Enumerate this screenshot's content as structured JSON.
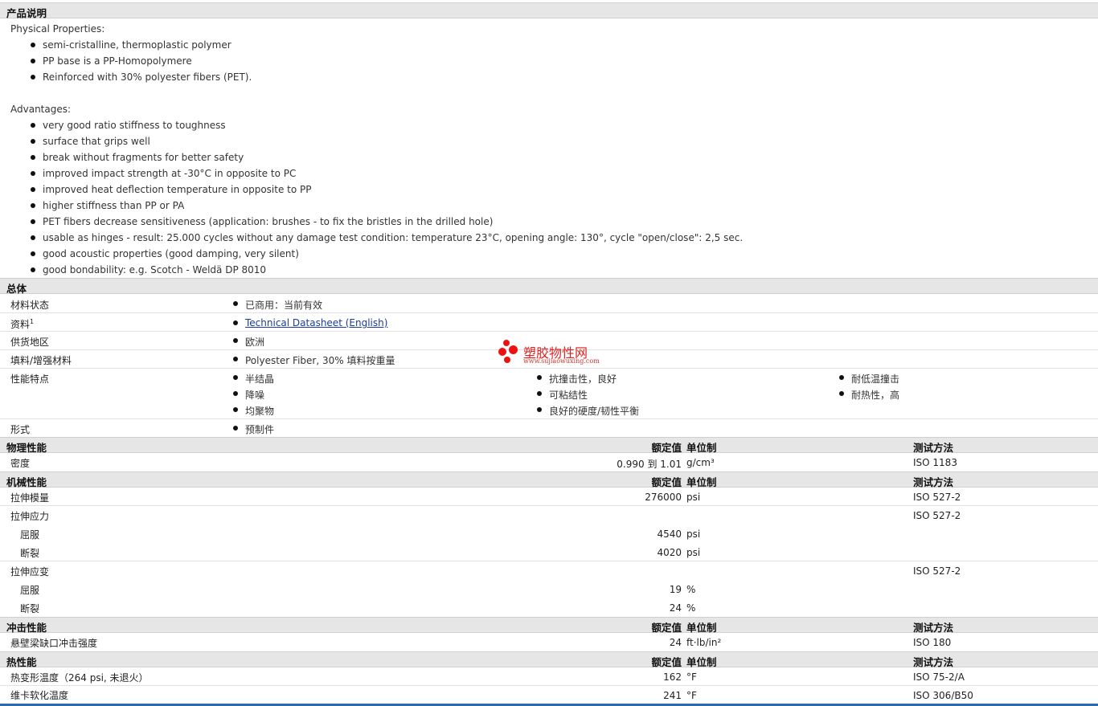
{
  "product_description": {
    "header": "产品说明",
    "physical_title": "Physical Properties:",
    "physical": [
      "semi-cristalline, thermoplastic polymer",
      "PP base is a PP-Homopolymere",
      "Reinforced with 30% polyester fibers (PET)."
    ],
    "advantages_title": "Advantages:",
    "advantages": [
      "very good ratio stiffness to toughness",
      "surface that grips well",
      "break without fragments for better safety",
      "improved impact strength at -30°C in opposite to PC",
      "improved heat deflection temperature in opposite to PP",
      "higher stiffness than PP or PA",
      "PET fibers decrease sensitiveness (application: brushes - to fix the bristles in the drilled hole)",
      "usable as hinges - result: 25.000 cycles without any damage test condition: temperature 23°C, opening angle: 130°, cycle \"open/close\": 2,5 sec.",
      "good acoustic properties (good damping, very silent)",
      "good bondability: e.g. Scotch - Weldä DP 8010"
    ]
  },
  "general": {
    "header": "总体",
    "status_label": "材料状态",
    "status_value": "已商用：当前有效",
    "docs_label": "资料",
    "docs_sup": "1",
    "docs_link": "Technical Datasheet (English)",
    "region_label": "供货地区",
    "region_value": "欧洲",
    "filler_label": "填料/增强材料",
    "filler_value": "Polyester Fiber, 30% 填料按重量",
    "features_label": "性能特点",
    "features": [
      "半结晶",
      "降噪",
      "均聚物",
      "抗撞击性，良好",
      "可粘结性",
      "良好的硬度/韧性平衡",
      "耐低温撞击",
      "耐热性，高"
    ],
    "form_label": "形式",
    "form_value": "预制件"
  },
  "columns": {
    "nominal": "额定值",
    "unit": "单位制",
    "method": "测试方法"
  },
  "physical": {
    "header": "物理性能",
    "density_label": "密度",
    "density_value": "0.990 到 1.01",
    "density_unit": "g/cm³",
    "density_method": "ISO 1183"
  },
  "mechanical": {
    "header": "机械性能",
    "modulus_label": "拉伸模量",
    "modulus_value": "276000",
    "modulus_unit": "psi",
    "modulus_method": "ISO 527-2",
    "stress_label": "拉伸应力",
    "stress_method": "ISO 527-2",
    "stress_yield_label": "屈服",
    "stress_yield_value": "4540",
    "stress_yield_unit": "psi",
    "stress_break_label": "断裂",
    "stress_break_value": "4020",
    "stress_break_unit": "psi",
    "strain_label": "拉伸应变",
    "strain_method": "ISO 527-2",
    "strain_yield_label": "屈服",
    "strain_yield_value": "19",
    "strain_yield_unit": "%",
    "strain_break_label": "断裂",
    "strain_break_value": "24",
    "strain_break_unit": "%"
  },
  "impact": {
    "header": "冲击性能",
    "izod_label": "悬壁梁缺口冲击强度",
    "izod_value": "24",
    "izod_unit": "ft·lb/in²",
    "izod_method": "ISO 180"
  },
  "thermal": {
    "header": "热性能",
    "hdt_label": "热变形温度（264 psi, 未退火）",
    "hdt_value": "162",
    "hdt_unit": "°F",
    "hdt_method": "ISO 75-2/A",
    "vicat_label": "维卡软化温度",
    "vicat_value": "241",
    "vicat_unit": "°F",
    "vicat_method": "ISO 306/B50"
  },
  "watermark": {
    "text": "塑胶物性网",
    "url": "www.sujiaowuxing.com",
    "color": "#e11111"
  }
}
